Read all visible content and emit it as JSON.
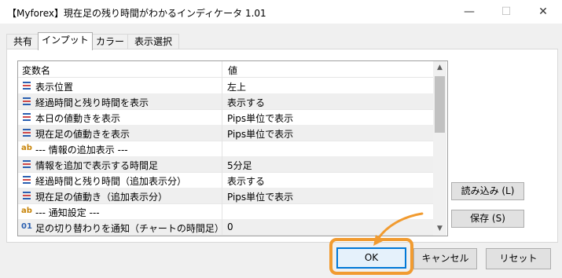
{
  "window": {
    "title": "【Myforex】現在足の残り時間がわかるインディケータ 1.01",
    "minimize": "—",
    "maximize": "☐",
    "close": "✕"
  },
  "tabs": [
    {
      "label": "共有"
    },
    {
      "label": "インプット",
      "active": true
    },
    {
      "label": "カラー"
    },
    {
      "label": "表示選択"
    }
  ],
  "grid": {
    "col_name": "変数名",
    "col_value": "値",
    "rows": [
      {
        "icon": "enum",
        "name": "表示位置",
        "value": "左上"
      },
      {
        "icon": "enum",
        "name": "経過時間と残り時間を表示",
        "value": "表示する"
      },
      {
        "icon": "enum",
        "name": "本日の値動きを表示",
        "value": "Pips単位で表示"
      },
      {
        "icon": "enum",
        "name": "現在足の値動きを表示",
        "value": "Pips単位で表示"
      },
      {
        "icon": "ab",
        "name": "--- 情報の追加表示 ---",
        "value": ""
      },
      {
        "icon": "enum",
        "name": "情報を追加で表示する時間足",
        "value": "5分足"
      },
      {
        "icon": "enum",
        "name": "経過時間と残り時間（追加表示分）",
        "value": "表示する"
      },
      {
        "icon": "enum",
        "name": "現在足の値動き（追加表示分）",
        "value": "Pips単位で表示"
      },
      {
        "icon": "ab",
        "name": "--- 通知設定 ---",
        "value": ""
      },
      {
        "icon": "01",
        "name": "足の切り替わりを通知（チャートの時間足）",
        "value": "0"
      }
    ]
  },
  "side_buttons": {
    "load": "読み込み (L)",
    "save": "保存 (S)"
  },
  "footer": {
    "ok": "OK",
    "cancel": "キャンセル",
    "reset": "リセット"
  },
  "colors": {
    "highlight": "#f19b30",
    "focus": "#0078d7"
  }
}
